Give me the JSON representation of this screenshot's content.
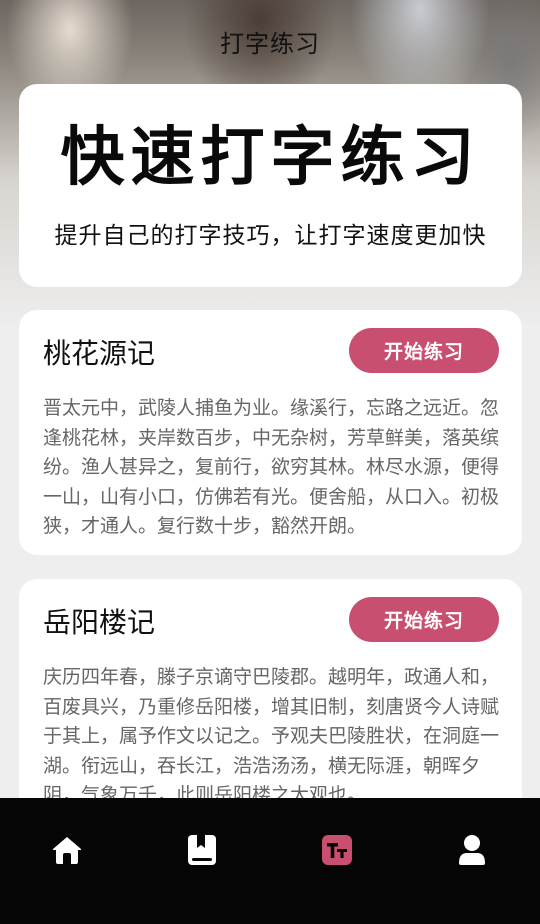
{
  "app_title": "打字练习",
  "hero": {
    "heading": "快速打字练习",
    "subtitle": "提升自己的打字技巧，让打字速度更加快"
  },
  "articles": [
    {
      "title": "桃花源记",
      "button": "开始练习",
      "text": "晋太元中，武陵人捕鱼为业。缘溪行，忘路之远近。忽逢桃花林，夹岸数百步，中无杂树，芳草鲜美，落英缤纷。渔人甚异之，复前行，欲穷其林。林尽水源，便得一山，山有小口，仿佛若有光。便舍船，从口入。初极狭，才通人。复行数十步，豁然开朗。"
    },
    {
      "title": "岳阳楼记",
      "button": "开始练习",
      "text": "庆历四年春，滕子京谪守巴陵郡。越明年，政通人和，百废具兴，乃重修岳阳楼，增其旧制，刻唐贤今人诗赋于其上，属予作文以记之。予观夫巴陵胜状，在洞庭一湖。衔远山，吞长江，浩浩汤汤，横无际涯，朝晖夕阴，气象万千，此则岳阳楼之大观也。"
    }
  ],
  "tabbar": {
    "active_color": "#c84f6f",
    "icons": [
      "home-icon",
      "book-icon",
      "typing-icon",
      "user-icon"
    ],
    "active_index": 2
  }
}
